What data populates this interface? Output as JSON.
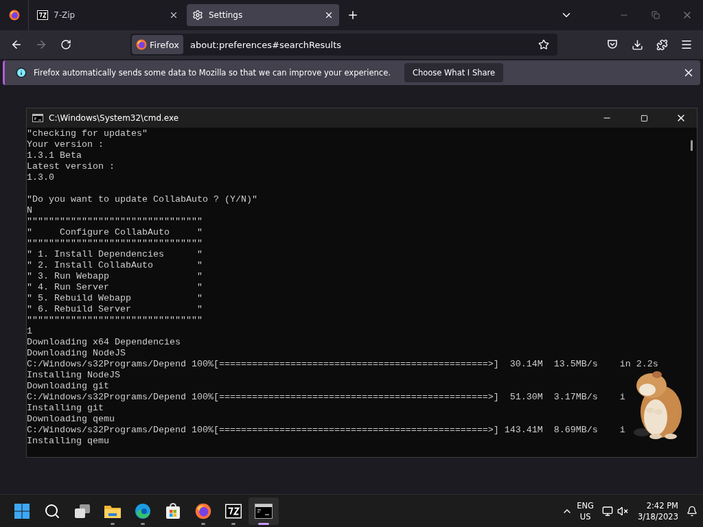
{
  "browser": {
    "tabs": [
      {
        "kind": "archive",
        "label": "7-Zip",
        "selected": false
      },
      {
        "kind": "settings",
        "label": "Settings",
        "selected": true
      }
    ],
    "url_badge": "Firefox",
    "url": "about:preferences#searchResults"
  },
  "notification": {
    "message": "Firefox automatically sends some data to Mozilla so that we can improve your experience.",
    "button": "Choose What I Share"
  },
  "console": {
    "title": "C:\\Windows\\System32\\cmd.exe",
    "blocks": [
      [
        "\"checking for updates\"",
        "Your version :",
        "1.3.1 Beta",
        "Latest version :",
        "1.3.0"
      ],
      [
        "\"Do you want to update CollabAuto ? (Y/N)\"",
        "N",
        "\"\"\"\"\"\"\"\"\"\"\"\"\"\"\"\"\"\"\"\"\"\"\"\"\"\"\"\"\"\"\"\"",
        "\"     Configure CollabAuto     \"",
        "\"\"\"\"\"\"\"\"\"\"\"\"\"\"\"\"\"\"\"\"\"\"\"\"\"\"\"\"\"\"\"\"",
        "\" 1. Install Dependencies      \"",
        "\" 2. Install CollabAuto        \"",
        "\" 3. Run Webapp                \"",
        "\" 4. Run Server                \"",
        "\" 5. Rebuild Webapp            \"",
        "\" 6. Rebuild Server            \"",
        "\"\"\"\"\"\"\"\"\"\"\"\"\"\"\"\"\"\"\"\"\"\"\"\"\"\"\"\"\"\"\"\"",
        "1",
        "Downloading x64 Dependencies",
        "Downloading NodeJS",
        "C:/Windows/s32Programs/Depend 100%[=================================================>]  30.14M  13.5MB/s    in 2.2s",
        "Installing NodeJS",
        "Downloading git",
        "C:/Windows/s32Programs/Depend 100%[=================================================>]  51.30M  3.17MB/s    i",
        "Installing git",
        "Downloading qemu",
        "C:/Windows/s32Programs/Depend 100%[=================================================>] 143.41M  8.69MB/s    i",
        "Installing qemu"
      ]
    ]
  },
  "taskbar": {
    "apps": [
      {
        "kind": "start",
        "running": false,
        "selected": false
      },
      {
        "kind": "search",
        "running": false,
        "selected": false
      },
      {
        "kind": "taskview",
        "running": false,
        "selected": false
      },
      {
        "kind": "folder",
        "running": true,
        "selected": false
      },
      {
        "kind": "edge",
        "running": true,
        "selected": false
      },
      {
        "kind": "store",
        "running": false,
        "selected": false
      },
      {
        "kind": "firefox",
        "running": true,
        "selected": false
      },
      {
        "kind": "archive",
        "running": true,
        "selected": false
      },
      {
        "kind": "terminal",
        "running": true,
        "selected": true
      }
    ],
    "language": "ENG",
    "region": "US",
    "time": "2:42 PM",
    "date": "3/18/2023"
  }
}
